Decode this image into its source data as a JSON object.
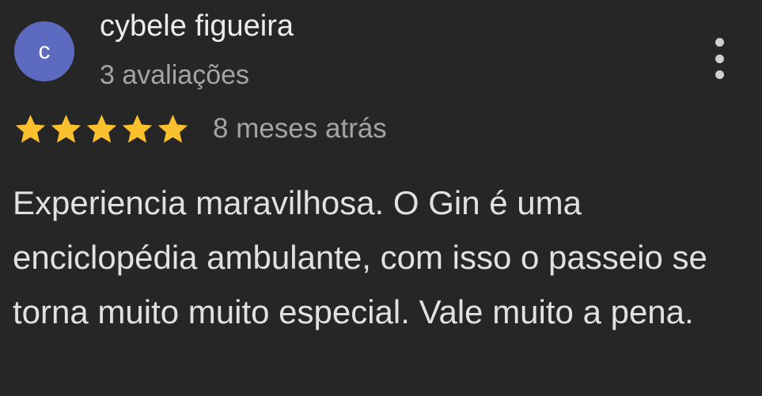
{
  "review": {
    "author": {
      "initial": "c",
      "name": "cybele figueira",
      "review_count": "3 avaliações",
      "avatar_color": "#5c6bc0"
    },
    "rating": {
      "stars": 5,
      "max_stars": 5,
      "star_color": "#fbc02d",
      "star_icon": "star-icon"
    },
    "date": "8 meses atrás",
    "text": "Experiencia maravilhosa. O Gin é uma enciclopédia ambulante, com isso o passeio se torna muito muito especial. Vale muito a pena.",
    "menu_icon": "more-vert-icon"
  }
}
